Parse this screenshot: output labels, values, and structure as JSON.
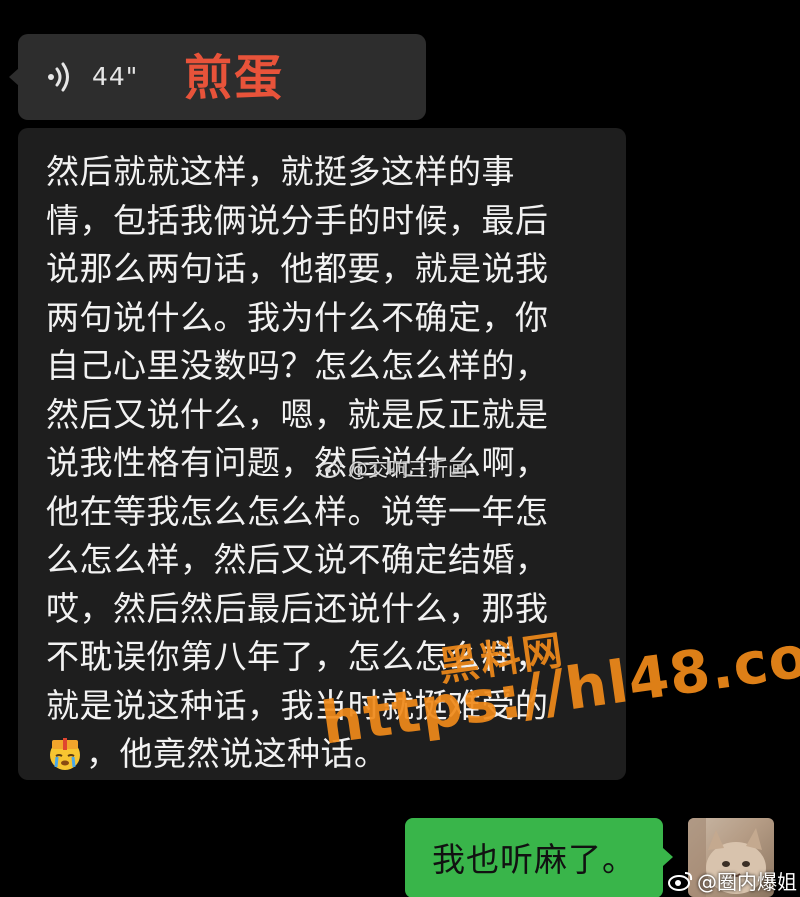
{
  "voice_message": {
    "duration": "44\"",
    "caller_name": "煎蛋"
  },
  "transcript": {
    "lines": [
      "然后就就这样，就挺多这样的事",
      "情，包括我俩说分手的时候，最后",
      "说那么两句话，他都要，就是说我",
      "两句说什么。我为什么不确定，你",
      "自己心里没数吗？怎么怎么样的，",
      "然后又说什么，嗯，就是反正就是",
      "说我性格有问题，然后说什么啊，",
      "他在等我怎么怎么样。说等一年怎",
      "么怎么样，然后又说不确定结婚，",
      "哎，然后然后最后还说什么，那我",
      "不耽误你第八年了，怎么怎么样，",
      "就是说这种话，我当时就挺难受的",
      "，他竟然说这种话。"
    ],
    "emoji": "crying-gift-emoji"
  },
  "reply": {
    "text": "我也听麻了。"
  },
  "watermarks": {
    "weibo_mid": "@交响三折画",
    "site_cn": "黑料网",
    "site_url": "https://hl48.co",
    "weibo_bottom": "@圈内爆姐"
  },
  "colors": {
    "background": "#000000",
    "incoming_bubble": "#2d2d2d",
    "transcript_bubble": "#1e1e1e",
    "outgoing_bubble": "#39b54a",
    "caller_name": "#e8533a",
    "watermark_orange": "#f08a1a"
  }
}
